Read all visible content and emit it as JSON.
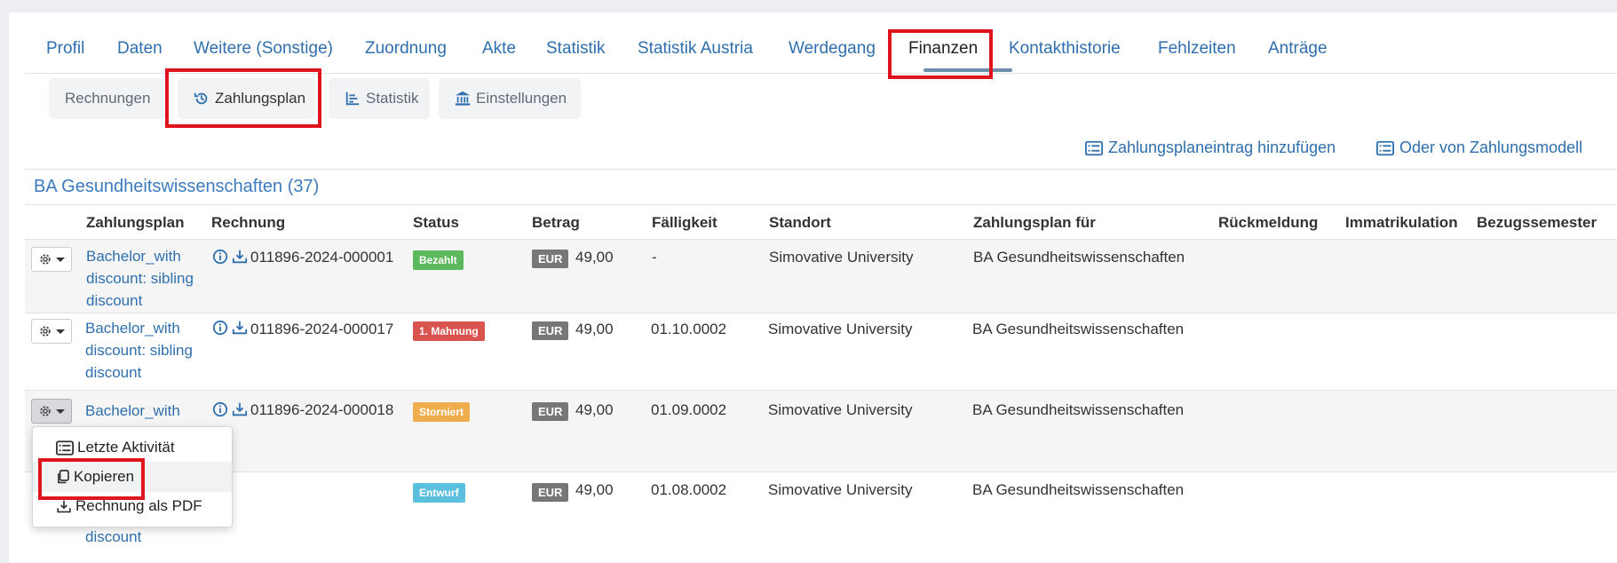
{
  "tabs": {
    "items": [
      "Profil",
      "Daten",
      "Weitere (Sonstige)",
      "Zuordnung",
      "Akte",
      "Statistik",
      "Statistik Austria",
      "Werdegang",
      "Finanzen",
      "Kontakthistorie",
      "Fehlzeiten",
      "Anträge"
    ],
    "active": "Finanzen"
  },
  "subtabs": {
    "rechnungen": "Rechnungen",
    "zahlungsplan": "Zahlungsplan",
    "statistik": "Statistik",
    "einstellungen": "Einstellungen"
  },
  "actions": {
    "add_entry": "Zahlungsplaneintrag hinzufügen",
    "from_model": "Oder von Zahlungsmodell"
  },
  "table": {
    "group_title": "BA Gesundheitswissenschaften (37)",
    "headers": [
      "Zahlungsplan",
      "Rechnung",
      "Status",
      "Betrag",
      "Fälligkeit",
      "Standort",
      "Zahlungsplan für",
      "Rückmeldung",
      "Immatrikulation",
      "Bezugssemester"
    ],
    "rows": [
      {
        "plan": "Bachelor_with discount: sibling discount",
        "invoice": "011896-2024-000001",
        "status": "Bezahlt",
        "currency": "EUR",
        "amount": "49,00",
        "due": "-",
        "location": "Simovative University",
        "plan_for": "BA Gesundheitswissenschaften"
      },
      {
        "plan": "Bachelor_with discount: sibling discount",
        "invoice": "011896-2024-000017",
        "status": "1. Mahnung",
        "currency": "EUR",
        "amount": "49,00",
        "due": "01.10.0002",
        "location": "Simovative University",
        "plan_for": "BA Gesundheitswissenschaften"
      },
      {
        "plan": "Bachelor_with",
        "invoice": "011896-2024-000018",
        "status": "Storniert",
        "currency": "EUR",
        "amount": "49,00",
        "due": "01.09.0002",
        "location": "Simovative University",
        "plan_for": "BA Gesundheitswissenschaften"
      },
      {
        "plan": "discount",
        "invoice": "",
        "status": "Entwurf",
        "currency": "EUR",
        "amount": "49,00",
        "due": "01.08.0002",
        "location": "Simovative University",
        "plan_for": "BA Gesundheitswissenschaften"
      }
    ]
  },
  "dropdown": {
    "items": [
      "Letzte Aktivität",
      "Kopieren",
      "Rechnung als PDF"
    ]
  },
  "colors": {
    "link": "#2f6fad",
    "bezahlt": "#5cb85c",
    "mahnung": "#d9534f",
    "storniert": "#f0ad4e",
    "entwurf": "#5bc0de",
    "highlight": "#e0141e"
  }
}
